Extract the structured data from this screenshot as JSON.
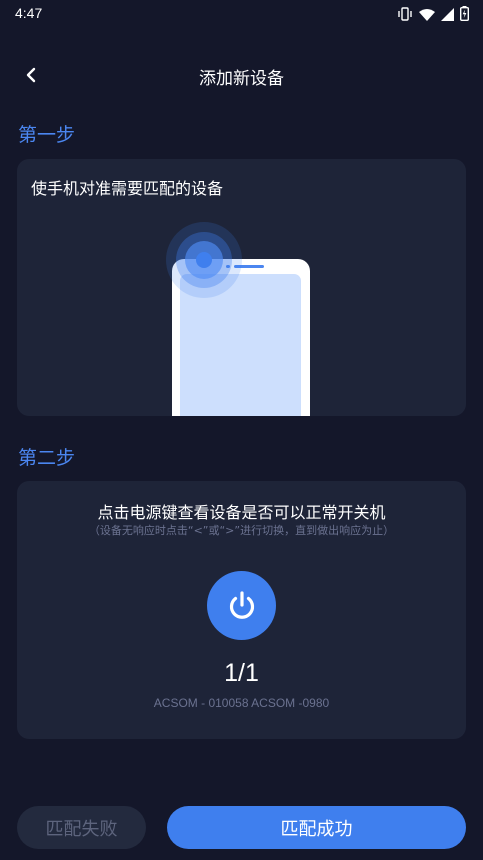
{
  "status_bar": {
    "time": "4:47",
    "icons": [
      "vibrate-icon",
      "wifi-icon",
      "signal-icon",
      "battery-icon"
    ]
  },
  "header": {
    "title": "添加新设备",
    "back_icon": "chevron-left-icon"
  },
  "step1": {
    "title": "第一步",
    "instruction": "使手机对准需要匹配的设备"
  },
  "step2": {
    "title": "第二步",
    "instruction": "点击电源键查看设备是否可以正常开关机",
    "hint": "（设备无响应时点击“<”或“>”进行切换，直到做出响应为止）",
    "power_icon": "power-icon",
    "counter": "1/1",
    "models": "ACSOM - 010058 ACSOM -0980"
  },
  "buttons": {
    "fail": "匹配失败",
    "success": "匹配成功"
  },
  "colors": {
    "background": "#14172a",
    "card": "#1e2438",
    "accent": "#3f7fee",
    "step_title": "#4b86f0",
    "muted_text": "#6b7290"
  }
}
